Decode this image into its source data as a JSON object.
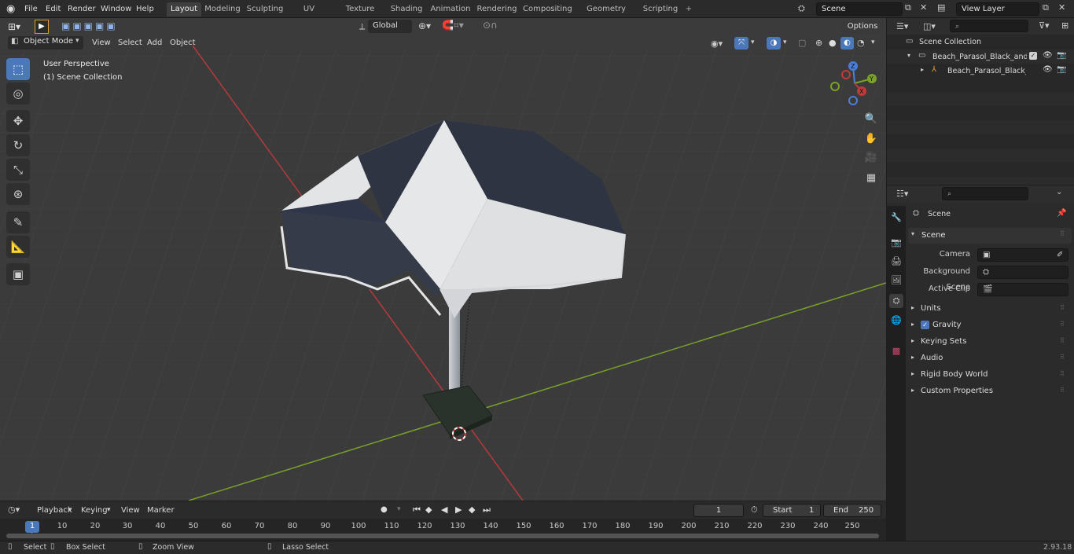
{
  "topbar": {
    "menus": [
      "File",
      "Edit",
      "Render",
      "Window",
      "Help"
    ],
    "workspaces": [
      "Layout",
      "Modeling",
      "Sculpting",
      "UV Editing",
      "Texture Paint",
      "Shading",
      "Animation",
      "Rendering",
      "Compositing",
      "Geometry Nodes",
      "Scripting"
    ],
    "active_workspace": "Layout",
    "add_tab": "+",
    "scene_name": "Scene",
    "view_layer": "View Layer"
  },
  "toolsettings": {
    "orientation": "Global",
    "options_label": "Options"
  },
  "viewport": {
    "mode": "Object Mode",
    "menus": [
      "View",
      "Select",
      "Add",
      "Object"
    ],
    "overlay_title": "User Perspective",
    "overlay_collection": "(1) Scene Collection",
    "gizmo": {
      "x": "X",
      "y": "Y",
      "z": "Z"
    }
  },
  "outliner": {
    "search_placeholder": "",
    "root": "Scene Collection",
    "items": [
      {
        "label": "Beach_Parasol_Black_and_Wl"
      },
      {
        "label": "Beach_Parasol_Black_an"
      }
    ]
  },
  "properties": {
    "breadcrumb": "Scene",
    "panel_title": "Scene",
    "fields": [
      {
        "label": "Camera",
        "value": ""
      },
      {
        "label": "Background Scene",
        "value": ""
      },
      {
        "label": "Active Clip",
        "value": ""
      }
    ],
    "sections": [
      "Units",
      "Gravity",
      "Keying Sets",
      "Audio",
      "Rigid Body World",
      "Custom Properties"
    ],
    "gravity_enabled": true
  },
  "timeline": {
    "menus": [
      "Playback",
      "Keying",
      "View",
      "Marker"
    ],
    "current_frame": "1",
    "start_label": "Start",
    "start_value": "1",
    "end_label": "End",
    "end_value": "250",
    "ruler": [
      "1",
      "10",
      "20",
      "30",
      "40",
      "50",
      "60",
      "70",
      "80",
      "90",
      "100",
      "110",
      "120",
      "130",
      "140",
      "150",
      "160",
      "170",
      "180",
      "190",
      "200",
      "210",
      "220",
      "230",
      "240",
      "250"
    ]
  },
  "statusbar": {
    "select": "Select",
    "box_select": "Box Select",
    "zoom_view": "Zoom View",
    "lasso_select": "Lasso Select",
    "version": "2.93.18"
  },
  "colors": {
    "accent": "#4a78b8",
    "x_axis": "#c0393b",
    "y_axis": "#7aa12a",
    "viewport_bg": "#3b3b3b"
  }
}
